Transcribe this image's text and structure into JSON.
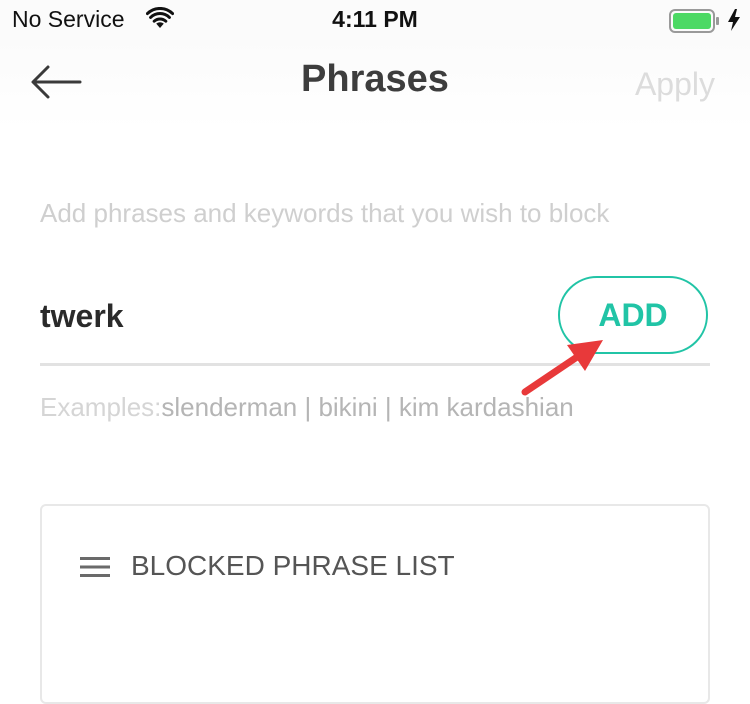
{
  "status_bar": {
    "carrier": "No Service",
    "time": "4:11 PM",
    "wifi_icon": "wifi-icon",
    "battery_icon": "battery-icon",
    "charging_icon": "charging-bolt-icon",
    "battery_color": "#4cd964"
  },
  "nav": {
    "back_icon": "back-arrow-icon",
    "title": "Phrases",
    "apply_label": "Apply"
  },
  "content": {
    "instructions": "Add phrases and keywords that you wish to block",
    "input_value": "twerk",
    "add_label": "ADD",
    "examples_label": "Examples:",
    "examples_values": "slenderman | bikini | kim kardashian",
    "accent_color": "#21c4a6",
    "annotation_color": "#e8393a"
  },
  "blocked_list": {
    "icon": "menu-icon",
    "title": "BLOCKED PHRASE LIST"
  }
}
